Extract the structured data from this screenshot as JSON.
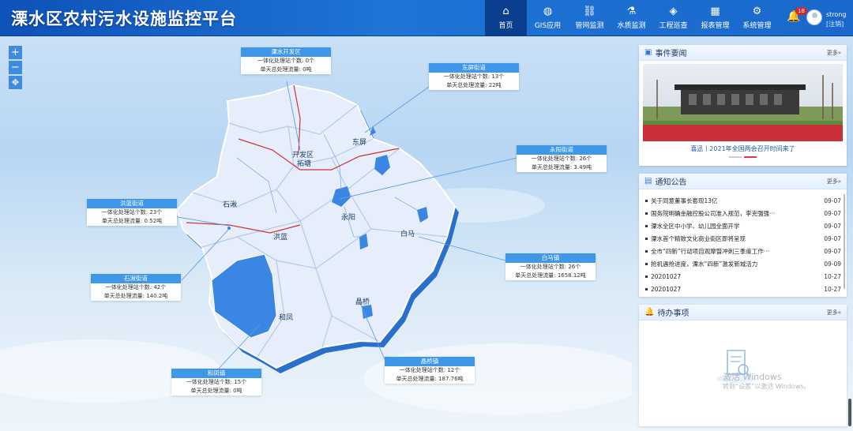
{
  "header": {
    "title": "溧水区农村污水设施监控平台",
    "nav": [
      {
        "label": "首页",
        "icon": "home-icon",
        "active": true
      },
      {
        "label": "GIS应用",
        "icon": "globe-icon"
      },
      {
        "label": "管网监测",
        "icon": "pipe-network-icon"
      },
      {
        "label": "水质监测",
        "icon": "flask-icon"
      },
      {
        "label": "工程巡查",
        "icon": "layers-icon"
      },
      {
        "label": "报表管理",
        "icon": "report-icon"
      },
      {
        "label": "系统管理",
        "icon": "settings-icon"
      }
    ],
    "notification_count": "18",
    "user": "strong",
    "logout": "[注销]"
  },
  "map": {
    "zoom_in": "+",
    "zoom_out": "−",
    "locate": "✥",
    "places": [
      "开发区",
      "拓塘",
      "东屏",
      "石湫",
      "永阳",
      "洪蓝",
      "白马",
      "和凤",
      "晶桥"
    ],
    "cards": [
      {
        "title": "溧水开发区",
        "station_label": "一体化处理站个数:",
        "station_value": "0个",
        "flow_label": "单天总处理流量:",
        "flow_value": "0吨"
      },
      {
        "title": "东屏街道",
        "station_label": "一体化处理站个数:",
        "station_value": "13个",
        "flow_label": "单天总处理流量:",
        "flow_value": "22吨"
      },
      {
        "title": "永阳街道",
        "station_label": "一体化处理站个数:",
        "station_value": "26个",
        "flow_label": "单天总处理流量:",
        "flow_value": "3.49吨"
      },
      {
        "title": "洪蓝街道",
        "station_label": "一体化处理站个数:",
        "station_value": "23个",
        "flow_label": "单天总处理流量:",
        "flow_value": "0.52吨"
      },
      {
        "title": "白马镇",
        "station_label": "一体化处理站个数:",
        "station_value": "26个",
        "flow_label": "单天总处理流量:",
        "flow_value": "1658.12吨"
      },
      {
        "title": "石湫街道",
        "station_label": "一体化处理站个数:",
        "station_value": "42个",
        "flow_label": "单天总处理流量:",
        "flow_value": "140.2吨"
      },
      {
        "title": "晶桥镇",
        "station_label": "一体化处理站个数:",
        "station_value": "12个",
        "flow_label": "单天总处理流量:",
        "flow_value": "187.76吨"
      },
      {
        "title": "和凤镇",
        "station_label": "一体化处理站个数:",
        "station_value": "15个",
        "flow_label": "单天总处理流量:",
        "flow_value": "0吨"
      }
    ]
  },
  "events": {
    "title": "事件要闻",
    "more": "更多»",
    "caption": "喜迅丨2021年全国两会召开时间来了"
  },
  "notices": {
    "title": "通知公告",
    "more": "更多»",
    "items": [
      {
        "text": "关于同意董事长套现13亿",
        "date": "09-07"
      },
      {
        "text": "国务院明确金融控股公司准入规范，李克强强···",
        "date": "09-07"
      },
      {
        "text": "溧水全区中小学、幼儿园全面开学",
        "date": "09-07"
      },
      {
        "text": "溧水首个精致文化商业街区即将呈现",
        "date": "09-07"
      },
      {
        "text": "全市“四新”行动项目观摩暨冲刺三季度工作···",
        "date": "09-07"
      },
      {
        "text": "抢机遇抢进度，溧水“四新”激发新城活力",
        "date": "09-09"
      },
      {
        "text": "20201027",
        "date": "10-27"
      },
      {
        "text": "20201027",
        "date": "10-27"
      }
    ]
  },
  "todo": {
    "title": "待办事项",
    "more": "更多»",
    "watermark_title": "激活 Windows",
    "watermark_sub": "转到“设置”以激活 Windows。"
  }
}
